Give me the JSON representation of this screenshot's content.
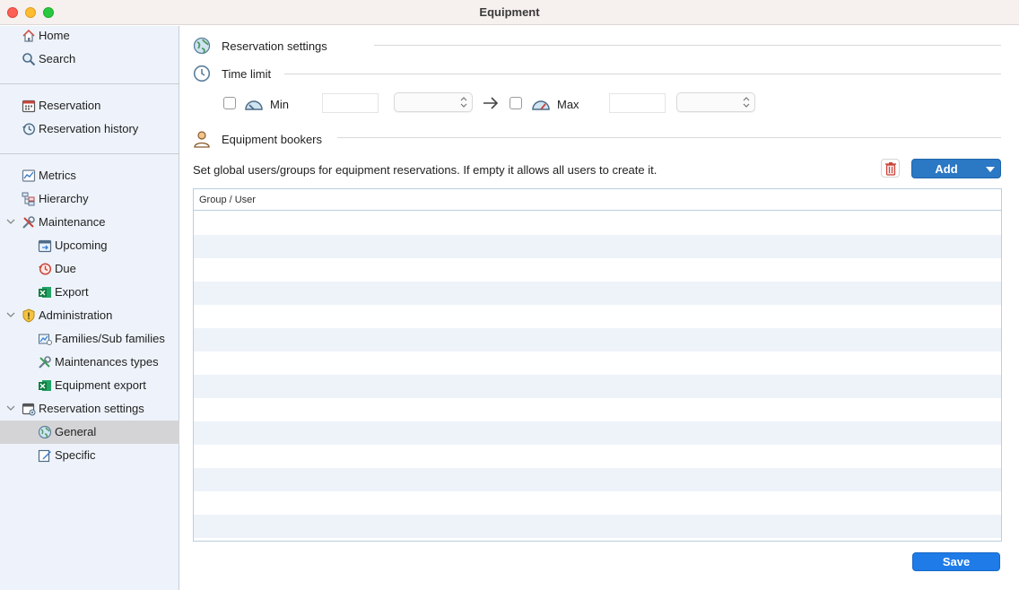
{
  "window": {
    "title": "Equipment"
  },
  "sidebar": {
    "items": [
      {
        "label": "Home",
        "icon": "home-icon"
      },
      {
        "label": "Search",
        "icon": "search-icon"
      },
      {
        "label": "Reservation",
        "icon": "calendar-icon"
      },
      {
        "label": "Reservation history",
        "icon": "history-icon"
      },
      {
        "label": "Metrics",
        "icon": "chart-icon"
      },
      {
        "label": "Hierarchy",
        "icon": "hierarchy-icon"
      },
      {
        "label": "Maintenance",
        "icon": "tools-icon",
        "expanded": true
      },
      {
        "label": "Upcoming",
        "icon": "upcoming-calendar-icon"
      },
      {
        "label": "Due",
        "icon": "due-clock-icon"
      },
      {
        "label": "Export",
        "icon": "excel-icon"
      },
      {
        "label": "Administration",
        "icon": "shield-icon",
        "expanded": true
      },
      {
        "label": "Families/Sub families",
        "icon": "families-icon"
      },
      {
        "label": "Maintenances types",
        "icon": "tools-icon"
      },
      {
        "label": "Equipment export",
        "icon": "excel-icon"
      },
      {
        "label": "Reservation settings",
        "icon": "calendar-settings-icon",
        "expanded": true
      },
      {
        "label": "General",
        "icon": "globe-icon",
        "selected": true
      },
      {
        "label": "Specific",
        "icon": "edit-icon"
      }
    ]
  },
  "main": {
    "section_reservation": "Reservation settings",
    "section_time_limit": "Time limit",
    "min_label": "Min",
    "max_label": "Max",
    "min_value": "",
    "max_value": "",
    "min_unit": "",
    "max_unit": "",
    "section_bookers": "Equipment bookers",
    "description": "Set global users/groups for equipment reservations. If empty it allows all users to create it.",
    "add_label": "Add",
    "table": {
      "columns": [
        "Group / User"
      ],
      "rows": []
    },
    "save_label": "Save"
  },
  "colors": {
    "accent": "#2b78c5",
    "save": "#1e7be8",
    "sidebar_bg": "#eef3fb",
    "selected_bg": "#d4d4d6",
    "row_alt": "#eef3fa"
  }
}
